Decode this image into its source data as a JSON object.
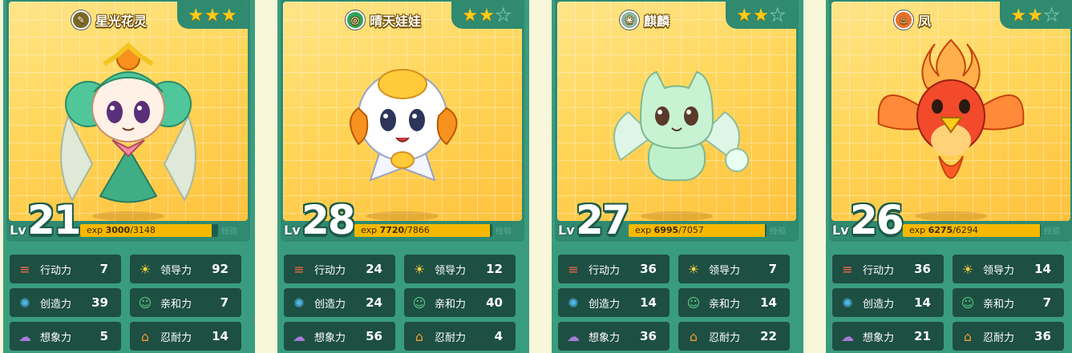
{
  "cards": [
    {
      "name": "星光花灵",
      "element_icon": "leaf-icon",
      "element_color": "#7a6a2a",
      "stars_filled": 3,
      "stars_total": 3,
      "level_label": "Lv",
      "level": "21",
      "exp_label": "exp",
      "exp_current": "3000",
      "exp_max": "/3148",
      "exp_fraction": 0.953,
      "exp_note": "经验",
      "stats": [
        {
          "label": "行动力",
          "value": "7",
          "icon": "speed-icon"
        },
        {
          "label": "领导力",
          "value": "92",
          "icon": "sun-icon"
        },
        {
          "label": "创造力",
          "value": "39",
          "icon": "bulb-icon"
        },
        {
          "label": "亲和力",
          "value": "7",
          "icon": "smile-icon"
        },
        {
          "label": "想象力",
          "value": "5",
          "icon": "cloud-icon"
        },
        {
          "label": "忍耐力",
          "value": "14",
          "icon": "shield-icon"
        }
      ]
    },
    {
      "name": "晴天娃娃",
      "element_icon": "wind-icon",
      "element_color": "#2fa35b",
      "stars_filled": 2,
      "stars_total": 3,
      "level_label": "Lv",
      "level": "28",
      "exp_label": "exp",
      "exp_current": "7720",
      "exp_max": "/7866",
      "exp_fraction": 0.981,
      "exp_note": "经验",
      "stats": [
        {
          "label": "行动力",
          "value": "24",
          "icon": "speed-icon"
        },
        {
          "label": "领导力",
          "value": "12",
          "icon": "sun-icon"
        },
        {
          "label": "创造力",
          "value": "24",
          "icon": "bulb-icon"
        },
        {
          "label": "亲和力",
          "value": "40",
          "icon": "smile-icon"
        },
        {
          "label": "想象力",
          "value": "56",
          "icon": "cloud-icon"
        },
        {
          "label": "忍耐力",
          "value": "4",
          "icon": "shield-icon"
        }
      ]
    },
    {
      "name": "麒麟",
      "element_icon": "cloud-element-icon",
      "element_color": "#8fb5a0",
      "stars_filled": 2,
      "stars_total": 3,
      "level_label": "Lv",
      "level": "27",
      "exp_label": "exp",
      "exp_current": "6995",
      "exp_max": "/7057",
      "exp_fraction": 0.991,
      "exp_note": "经验",
      "stats": [
        {
          "label": "行动力",
          "value": "36",
          "icon": "speed-icon"
        },
        {
          "label": "领导力",
          "value": "7",
          "icon": "sun-icon"
        },
        {
          "label": "创造力",
          "value": "14",
          "icon": "bulb-icon"
        },
        {
          "label": "亲和力",
          "value": "14",
          "icon": "smile-icon"
        },
        {
          "label": "想象力",
          "value": "36",
          "icon": "cloud-icon"
        },
        {
          "label": "忍耐力",
          "value": "22",
          "icon": "shield-icon"
        }
      ]
    },
    {
      "name": "凤",
      "element_icon": "fire-icon",
      "element_color": "#e8702a",
      "stars_filled": 2,
      "stars_total": 3,
      "level_label": "Lv",
      "level": "26",
      "exp_label": "exp",
      "exp_current": "6275",
      "exp_max": "/6294",
      "exp_fraction": 0.997,
      "exp_note": "经验",
      "stats": [
        {
          "label": "行动力",
          "value": "36",
          "icon": "speed-icon"
        },
        {
          "label": "领导力",
          "value": "14",
          "icon": "sun-icon"
        },
        {
          "label": "创造力",
          "value": "14",
          "icon": "bulb-icon"
        },
        {
          "label": "亲和力",
          "value": "7",
          "icon": "smile-icon"
        },
        {
          "label": "想象力",
          "value": "21",
          "icon": "cloud-icon"
        },
        {
          "label": "忍耐力",
          "value": "36",
          "icon": "shield-icon"
        }
      ]
    }
  ]
}
